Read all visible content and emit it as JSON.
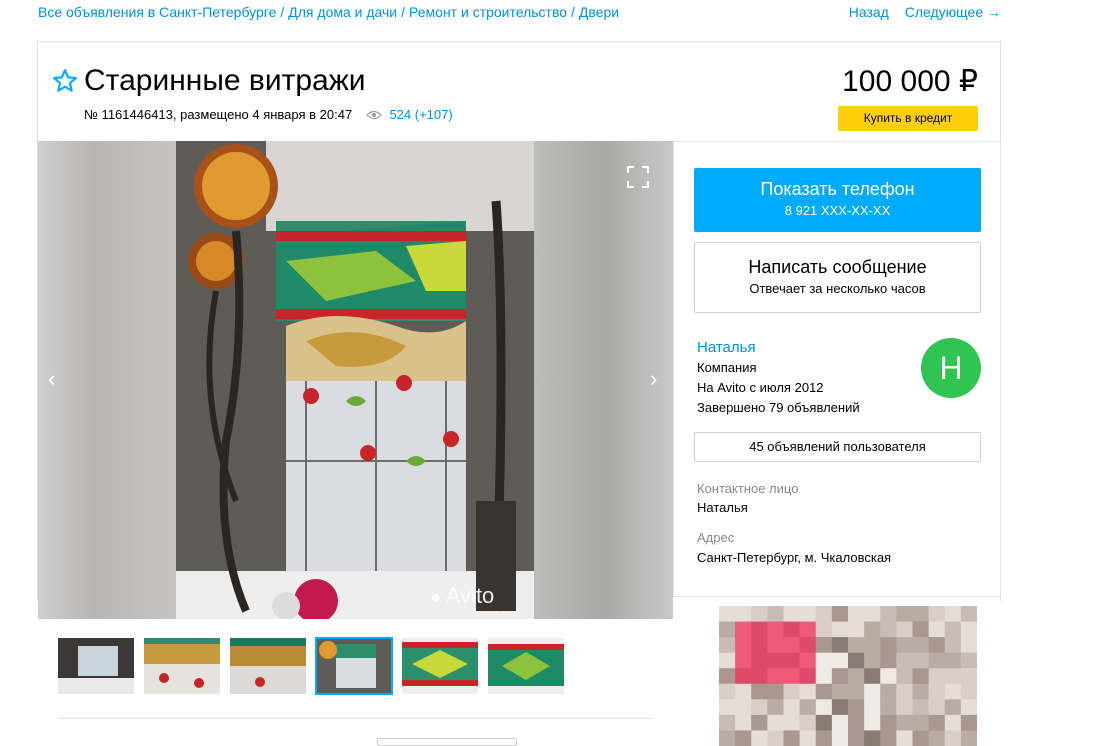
{
  "breadcrumb": {
    "items": [
      "Все объявления в Санкт-Петербурге",
      "Для дома и дачи",
      "Ремонт и строительство",
      "Двери"
    ],
    "separator": "/"
  },
  "nav": {
    "back": "Назад",
    "next": "Следующее →"
  },
  "listing": {
    "title": "Старинные витражи",
    "meta": "№ 1161446413, размещено 4 января в 20:47",
    "views": "524 (+107)",
    "price": "100 000 ₽",
    "credit_label": "Купить в кредит"
  },
  "gallery": {
    "watermark": "Avito",
    "thumb_count": 6,
    "active_thumb": 4
  },
  "contact": {
    "phone_title": "Показать телефон",
    "phone_number": "8 921 XXX-XX-XX",
    "message_title": "Написать сообщение",
    "message_sub": "Отвечает за несколько часов"
  },
  "seller": {
    "name": "Наталья",
    "type": "Компания",
    "since": "На Avito с июля 2012",
    "completed": "Завершено 79 объявлений",
    "avatar_letter": "Н",
    "ads_button": "45 объявлений пользователя",
    "contact_label": "Контактное лицо",
    "contact_name": "Наталья",
    "address_label": "Адрес",
    "address": "Санкт-Петербург, м. Чкаловская"
  },
  "colors": {
    "link": "#0091d9",
    "primary": "#00aaff",
    "credit": "#ffcf0e",
    "avatar": "#30c452"
  },
  "icons": [
    "star-icon",
    "eye-icon",
    "chevron-left-icon",
    "chevron-right-icon",
    "fullscreen-icon"
  ]
}
